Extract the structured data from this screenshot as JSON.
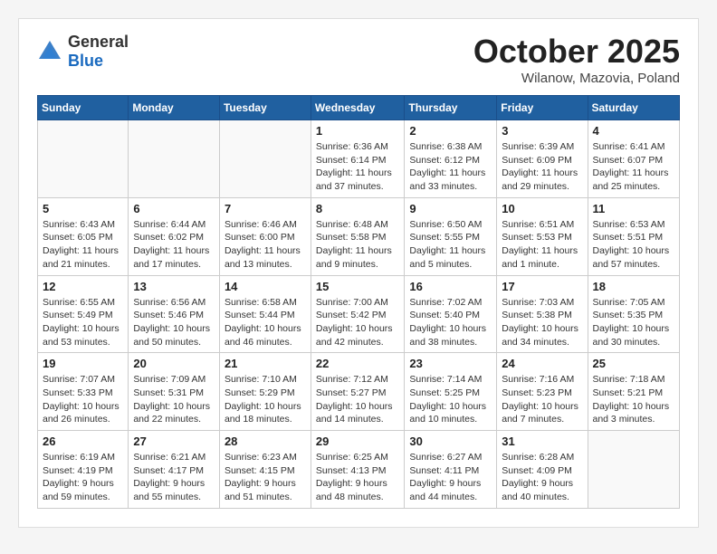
{
  "logo": {
    "general": "General",
    "blue": "Blue"
  },
  "header": {
    "month_year": "October 2025",
    "location": "Wilanow, Mazovia, Poland"
  },
  "weekdays": [
    "Sunday",
    "Monday",
    "Tuesday",
    "Wednesday",
    "Thursday",
    "Friday",
    "Saturday"
  ],
  "weeks": [
    [
      {
        "day": "",
        "info": ""
      },
      {
        "day": "",
        "info": ""
      },
      {
        "day": "",
        "info": ""
      },
      {
        "day": "1",
        "info": "Sunrise: 6:36 AM\nSunset: 6:14 PM\nDaylight: 11 hours\nand 37 minutes."
      },
      {
        "day": "2",
        "info": "Sunrise: 6:38 AM\nSunset: 6:12 PM\nDaylight: 11 hours\nand 33 minutes."
      },
      {
        "day": "3",
        "info": "Sunrise: 6:39 AM\nSunset: 6:09 PM\nDaylight: 11 hours\nand 29 minutes."
      },
      {
        "day": "4",
        "info": "Sunrise: 6:41 AM\nSunset: 6:07 PM\nDaylight: 11 hours\nand 25 minutes."
      }
    ],
    [
      {
        "day": "5",
        "info": "Sunrise: 6:43 AM\nSunset: 6:05 PM\nDaylight: 11 hours\nand 21 minutes."
      },
      {
        "day": "6",
        "info": "Sunrise: 6:44 AM\nSunset: 6:02 PM\nDaylight: 11 hours\nand 17 minutes."
      },
      {
        "day": "7",
        "info": "Sunrise: 6:46 AM\nSunset: 6:00 PM\nDaylight: 11 hours\nand 13 minutes."
      },
      {
        "day": "8",
        "info": "Sunrise: 6:48 AM\nSunset: 5:58 PM\nDaylight: 11 hours\nand 9 minutes."
      },
      {
        "day": "9",
        "info": "Sunrise: 6:50 AM\nSunset: 5:55 PM\nDaylight: 11 hours\nand 5 minutes."
      },
      {
        "day": "10",
        "info": "Sunrise: 6:51 AM\nSunset: 5:53 PM\nDaylight: 11 hours\nand 1 minute."
      },
      {
        "day": "11",
        "info": "Sunrise: 6:53 AM\nSunset: 5:51 PM\nDaylight: 10 hours\nand 57 minutes."
      }
    ],
    [
      {
        "day": "12",
        "info": "Sunrise: 6:55 AM\nSunset: 5:49 PM\nDaylight: 10 hours\nand 53 minutes."
      },
      {
        "day": "13",
        "info": "Sunrise: 6:56 AM\nSunset: 5:46 PM\nDaylight: 10 hours\nand 50 minutes."
      },
      {
        "day": "14",
        "info": "Sunrise: 6:58 AM\nSunset: 5:44 PM\nDaylight: 10 hours\nand 46 minutes."
      },
      {
        "day": "15",
        "info": "Sunrise: 7:00 AM\nSunset: 5:42 PM\nDaylight: 10 hours\nand 42 minutes."
      },
      {
        "day": "16",
        "info": "Sunrise: 7:02 AM\nSunset: 5:40 PM\nDaylight: 10 hours\nand 38 minutes."
      },
      {
        "day": "17",
        "info": "Sunrise: 7:03 AM\nSunset: 5:38 PM\nDaylight: 10 hours\nand 34 minutes."
      },
      {
        "day": "18",
        "info": "Sunrise: 7:05 AM\nSunset: 5:35 PM\nDaylight: 10 hours\nand 30 minutes."
      }
    ],
    [
      {
        "day": "19",
        "info": "Sunrise: 7:07 AM\nSunset: 5:33 PM\nDaylight: 10 hours\nand 26 minutes."
      },
      {
        "day": "20",
        "info": "Sunrise: 7:09 AM\nSunset: 5:31 PM\nDaylight: 10 hours\nand 22 minutes."
      },
      {
        "day": "21",
        "info": "Sunrise: 7:10 AM\nSunset: 5:29 PM\nDaylight: 10 hours\nand 18 minutes."
      },
      {
        "day": "22",
        "info": "Sunrise: 7:12 AM\nSunset: 5:27 PM\nDaylight: 10 hours\nand 14 minutes."
      },
      {
        "day": "23",
        "info": "Sunrise: 7:14 AM\nSunset: 5:25 PM\nDaylight: 10 hours\nand 10 minutes."
      },
      {
        "day": "24",
        "info": "Sunrise: 7:16 AM\nSunset: 5:23 PM\nDaylight: 10 hours\nand 7 minutes."
      },
      {
        "day": "25",
        "info": "Sunrise: 7:18 AM\nSunset: 5:21 PM\nDaylight: 10 hours\nand 3 minutes."
      }
    ],
    [
      {
        "day": "26",
        "info": "Sunrise: 6:19 AM\nSunset: 4:19 PM\nDaylight: 9 hours\nand 59 minutes."
      },
      {
        "day": "27",
        "info": "Sunrise: 6:21 AM\nSunset: 4:17 PM\nDaylight: 9 hours\nand 55 minutes."
      },
      {
        "day": "28",
        "info": "Sunrise: 6:23 AM\nSunset: 4:15 PM\nDaylight: 9 hours\nand 51 minutes."
      },
      {
        "day": "29",
        "info": "Sunrise: 6:25 AM\nSunset: 4:13 PM\nDaylight: 9 hours\nand 48 minutes."
      },
      {
        "day": "30",
        "info": "Sunrise: 6:27 AM\nSunset: 4:11 PM\nDaylight: 9 hours\nand 44 minutes."
      },
      {
        "day": "31",
        "info": "Sunrise: 6:28 AM\nSunset: 4:09 PM\nDaylight: 9 hours\nand 40 minutes."
      },
      {
        "day": "",
        "info": ""
      }
    ]
  ]
}
